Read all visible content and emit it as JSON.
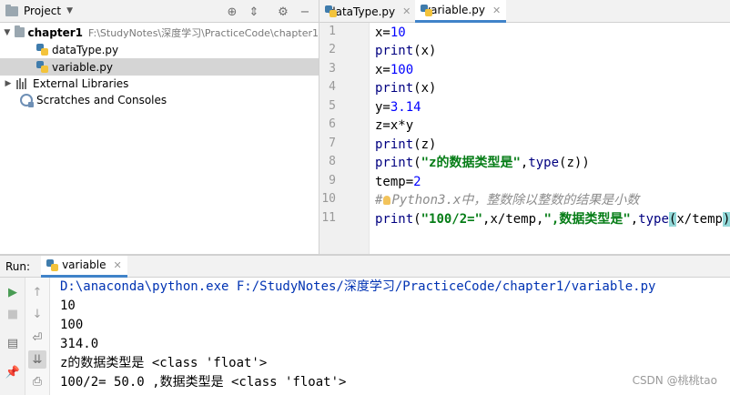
{
  "project": {
    "title": "Project",
    "tree": [
      {
        "label": "chapter1",
        "path": "F:\\StudyNotes\\深度学习\\PracticeCode\\chapter1"
      },
      {
        "label": "dataType.py"
      },
      {
        "label": "variable.py"
      },
      {
        "label": "External Libraries"
      },
      {
        "label": "Scratches and Consoles"
      }
    ]
  },
  "editor": {
    "tabs": [
      {
        "label": "dataType.py",
        "active": false
      },
      {
        "label": "variable.py",
        "active": true
      }
    ],
    "line_numbers": [
      "1",
      "2",
      "3",
      "4",
      "5",
      "6",
      "7",
      "8",
      "9",
      "10",
      "11"
    ],
    "current_line": 11
  },
  "run": {
    "label": "Run:",
    "tab_label": "variable",
    "console": [
      "D:\\anaconda\\python.exe F:/StudyNotes/深度学习/PracticeCode/chapter1/variable.py",
      "10",
      "100",
      "314.0",
      "z的数据类型是 <class 'float'>",
      "100/2= 50.0 ,数据类型是 <class 'float'>"
    ]
  },
  "watermark": "CSDN @桃桃tao",
  "colors": {
    "accent": "#4083c9",
    "keyword_builtin": "#000080",
    "number": "#0000ff",
    "string": "#067d17",
    "comment": "#8c8c8c",
    "command": "#0033b3"
  }
}
